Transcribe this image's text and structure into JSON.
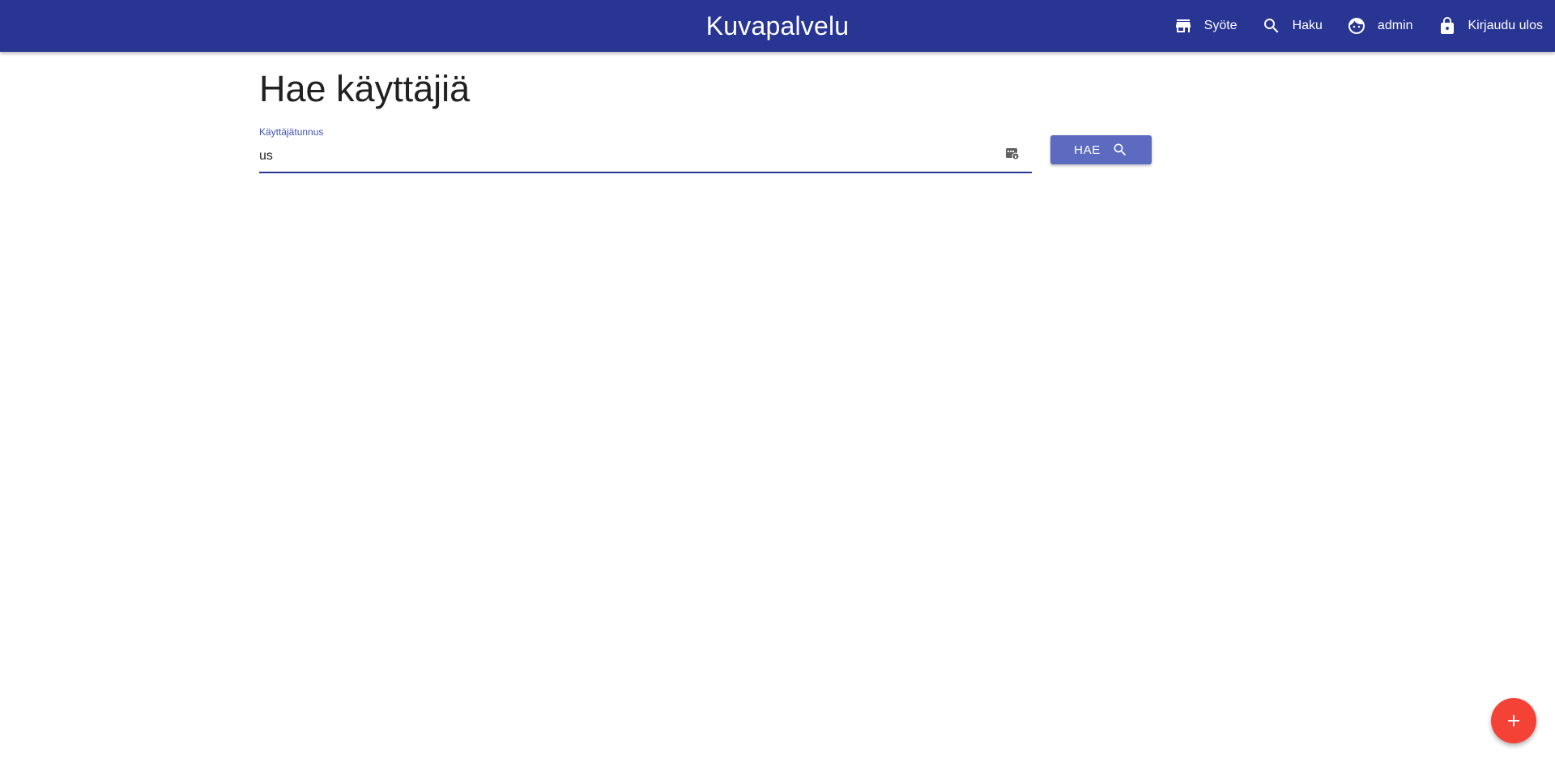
{
  "app": {
    "title": "Kuvapalvelu",
    "accent_color": "#283593"
  },
  "nav": {
    "items": [
      {
        "label": "Syöte",
        "icon": "store-icon"
      },
      {
        "label": "Haku",
        "icon": "search-icon"
      },
      {
        "label": "admin",
        "icon": "face-icon"
      },
      {
        "label": "Kirjaudu ulos",
        "icon": "lock-icon"
      }
    ]
  },
  "page": {
    "title": "Hae käyttäjiä"
  },
  "search_form": {
    "label": "Käyttäjätunnus",
    "value": "us",
    "adornment_icon": "password-manager-icon",
    "button_label": "HAE",
    "button_icon": "search-icon",
    "button_color": "#5c6bc0"
  },
  "fab": {
    "icon": "plus-icon",
    "color": "#f44336"
  }
}
